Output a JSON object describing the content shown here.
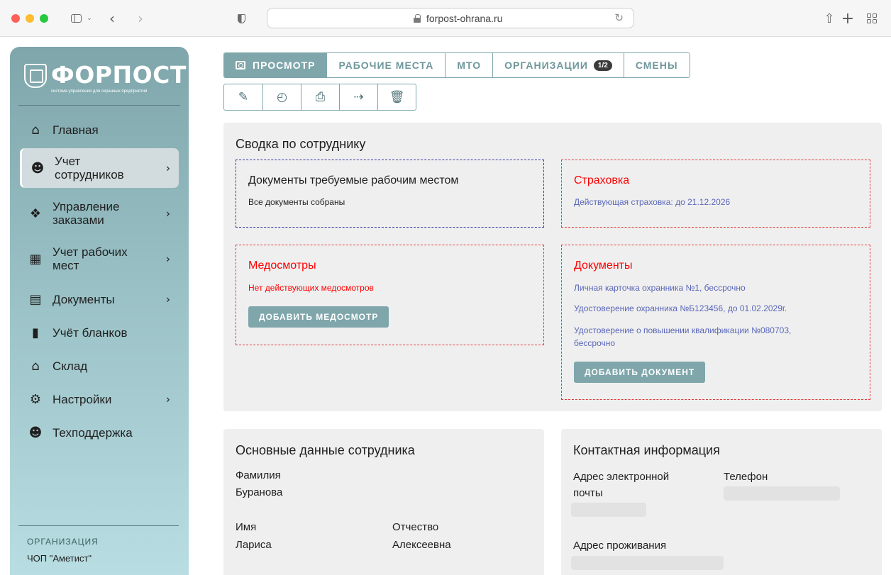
{
  "browser": {
    "url": "forpost-ohrana.ru"
  },
  "app": {
    "logo_title": "ФОРПОСТ",
    "logo_subtitle": "система управления для охранных предприятий"
  },
  "sidebar": {
    "items": [
      {
        "label": "Главная",
        "icon": "home-icon",
        "active": false,
        "has_submenu": false
      },
      {
        "label": "Учет сотрудников",
        "icon": "people-icon",
        "active": true,
        "has_submenu": true
      },
      {
        "label": "Управление заказами",
        "icon": "handshake-icon",
        "active": false,
        "has_submenu": true
      },
      {
        "label": "Учет рабочих мест",
        "icon": "building-icon",
        "active": false,
        "has_submenu": true
      },
      {
        "label": "Документы",
        "icon": "document-list-icon",
        "active": false,
        "has_submenu": true
      },
      {
        "label": "Учёт бланков",
        "icon": "file-icon",
        "active": false,
        "has_submenu": false
      },
      {
        "label": "Склад",
        "icon": "warehouse-icon",
        "active": false,
        "has_submenu": false
      },
      {
        "label": "Настройки",
        "icon": "gear-icon",
        "active": false,
        "has_submenu": true
      },
      {
        "label": "Техподдержка",
        "icon": "support-icon",
        "active": false,
        "has_submenu": false
      }
    ],
    "org_label": "ОРГАНИЗАЦИЯ",
    "org_value": "ЧОП \"Аметист\""
  },
  "tabs": [
    {
      "label": "ПРОСМОТР",
      "active": true
    },
    {
      "label": "РАБОЧИЕ МЕСТА",
      "active": false
    },
    {
      "label": "МТО",
      "active": false
    },
    {
      "label": "ОРГАНИЗАЦИИ",
      "active": false,
      "badge": "1/2"
    },
    {
      "label": "СМЕНЫ",
      "active": false
    }
  ],
  "toolbar": {
    "icons": [
      "edit-icon",
      "history-icon",
      "print-icon",
      "logout-icon",
      "delete-icon"
    ]
  },
  "summary": {
    "title": "Сводка по сотруднику",
    "required_docs": {
      "title": "Документы требуемые рабочим местом",
      "status": "Все документы собраны"
    },
    "insurance": {
      "title": "Страховка",
      "status": "Действующая страховка: до 21.12.2026"
    },
    "medical": {
      "title": "Медосмотры",
      "status": "Нет действующих медосмотров",
      "button": "ДОБАВИТЬ МЕДОСМОТР"
    },
    "documents": {
      "title": "Документы",
      "items": [
        "Личная карточка охранника №1, бессрочно",
        "Удостоверение охранника №Б123456, до 01.02.2029г.",
        "Удостоверение о повышении квалификации №080703, бессрочно"
      ],
      "button": "ДОБАВИТЬ ДОКУМЕНТ"
    }
  },
  "employee": {
    "title": "Основные данные сотрудника",
    "surname_label": "Фамилия",
    "surname": "Буранова",
    "name_label": "Имя",
    "name": "Лариса",
    "patronymic_label": "Отчество",
    "patronymic": "Алексеевна"
  },
  "contacts": {
    "title": "Контактная информация",
    "email_label": "Адрес электронной почты",
    "phone_label": "Телефон",
    "address_label": "Адрес проживания"
  },
  "colors": {
    "accent": "#7ea6ab",
    "error": "#ff0000",
    "link": "#5a67b8"
  }
}
